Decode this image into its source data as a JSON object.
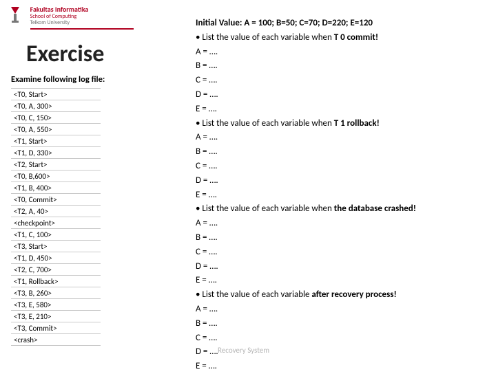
{
  "logo": {
    "line1": "TELKOM UNIVERSITY",
    "line2": "Fakultas Informatika",
    "line3": "School of Computing",
    "line4": "Telkom University"
  },
  "title": "Exercise",
  "subtitle": "Examine following log file:",
  "log": [
    "<T0, Start>",
    "<T0, A, 300>",
    "<T0, C, 150>",
    "<T0, A, 550>",
    "<T1, Start>",
    "<T1, D, 330>",
    "<T2, Start>",
    "<T0, B,600>",
    "<T1, B, 400>",
    "<T0, Commit>",
    "<T2, A, 40>",
    "<checkpoint>",
    "<T1, C, 100>",
    "<T3, Start>",
    "<T1, D, 450>",
    "<T2, C, 700>",
    "<T1, Rollback>",
    "<T3, B, 260>",
    "<T3, E, 580>",
    "<T3, E, 210>",
    "<T3, Commit>",
    "<crash>"
  ],
  "right": {
    "initial": "Initial Value: A = 100; B=50; C=70; D=220; E=120",
    "sections": [
      {
        "bullet_prefix": "• List the value of each variable when ",
        "bullet_bold": "T 0 commit!",
        "lines": [
          "A = ….",
          "B = ….",
          "C = ….",
          "D = ….",
          "E = …."
        ]
      },
      {
        "bullet_prefix": "• List the value of each variable when ",
        "bullet_bold": "T 1 rollback!",
        "lines": [
          "A = ….",
          "B = ….",
          "C = ….",
          "D = ….",
          "E = …."
        ]
      },
      {
        "bullet_prefix": "• List the value of each variable when ",
        "bullet_bold": "the database crashed!",
        "lines": [
          "A = ….",
          "B = ….",
          "C = ….",
          "D = ….",
          "E = …."
        ]
      },
      {
        "bullet_prefix": "• List the value of each variable ",
        "bullet_bold": "after recovery process!",
        "lines": [
          "A = ….",
          "B = ….",
          "C = ….",
          "D = ….",
          "E = …."
        ]
      }
    ]
  },
  "footer": "Recovery System"
}
